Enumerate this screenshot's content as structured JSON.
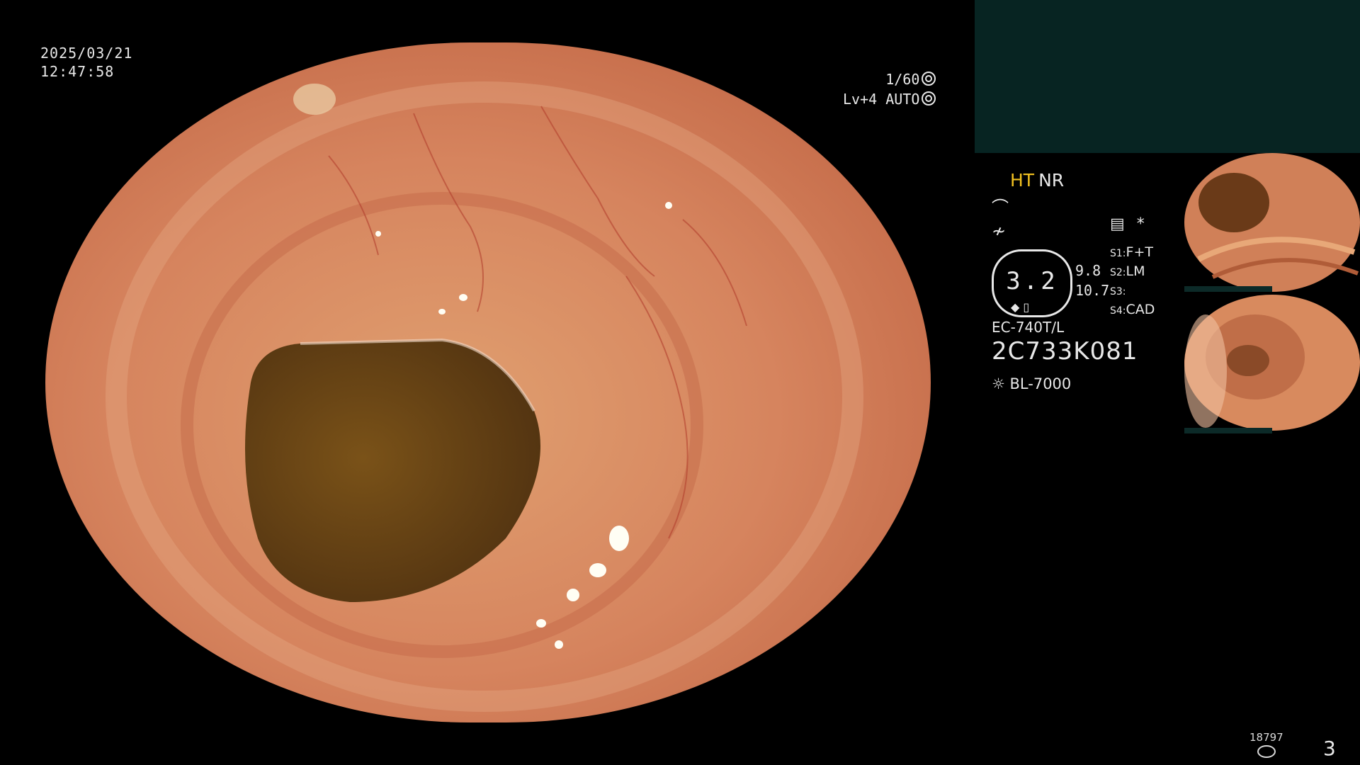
{
  "overlay": {
    "date": "2025/03/21",
    "time": "12:47:58",
    "shutter": "1/60",
    "level": "Lv+4",
    "mode": "AUTO"
  },
  "panel": {
    "ht_label": "HT",
    "nr_label": "NR",
    "glyph1": "⌒",
    "glyph2": "≁",
    "oct_value": "3.2",
    "side_val1": "9.8",
    "side_val2": "10.7",
    "asterisk": "*",
    "settings": [
      {
        "label": "S1:",
        "value": "F+T"
      },
      {
        "label": "S2:",
        "value": "LM"
      },
      {
        "label": "S3:",
        "value": ""
      },
      {
        "label": "S4:",
        "value": "CAD"
      }
    ],
    "model": "EC-740T/L",
    "serial": "2C733K081",
    "light_source": "BL-7000"
  },
  "footer": {
    "count": "18797",
    "page": "3"
  },
  "colors": {
    "ht": "#f0c020",
    "top_panel": "#072422",
    "mucosa": "#d07858",
    "lumen": "#6a4414"
  },
  "icons": {
    "shutter_icon": "aperture-icon",
    "mode_icon": "target-icon",
    "light_icon": "sun-icon",
    "disk_icon": "disk-icon",
    "menu_icon": "list-icon"
  }
}
